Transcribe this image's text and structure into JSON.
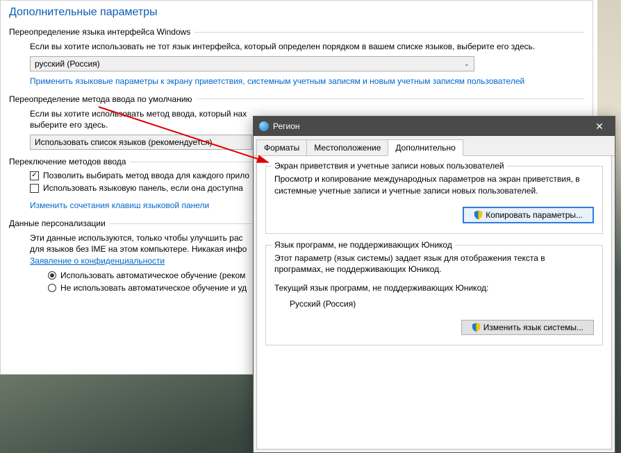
{
  "page": {
    "title": "Дополнительные параметры"
  },
  "group1": {
    "heading": "Переопределение языка интерфейса Windows",
    "desc": "Если вы хотите использовать не тот язык интерфейса, который определен порядком в вашем списке языков, выберите его здесь.",
    "dropdown_value": "русский (Россия)",
    "link": "Применить языковые параметры к экрану приветствия, системным учетным записям и новым учетным записям пользователей"
  },
  "group2": {
    "heading": "Переопределение метода ввода по умолчанию",
    "desc": "Если вы хотите использовать метод ввода, который нах",
    "dropdown_value": "Использовать список языков (рекомендуется)",
    "desc2": "выберите его здесь."
  },
  "group3": {
    "heading": "Переключение методов ввода",
    "check1": "Позволить выбирать метод ввода для каждого прило",
    "check2": "Использовать языковую панель, если она доступна",
    "link": "Изменить сочетания клавиш языковой панели"
  },
  "group4": {
    "heading": "Данные персонализации",
    "desc": "Эти данные используются, только чтобы улучшить рас",
    "desc2": "для языков без IME на этом компьютере. Никакая инфо",
    "link": "Заявление о конфиденциальности",
    "radio1": "Использовать автоматическое обучение (реком",
    "radio2": "Не использовать автоматическое обучение и уд"
  },
  "dialog": {
    "title": "Регион",
    "tabs": {
      "t1": "Форматы",
      "t2": "Местоположение",
      "t3": "Дополнительно"
    },
    "box1": {
      "legend": "Экран приветствия и учетные записи новых пользователей",
      "desc": "Просмотр и копирование международных параметров на экран приветствия, в системные учетные записи и учетные записи новых пользователей.",
      "button": "Копировать параметры..."
    },
    "box2": {
      "legend": "Язык программ, не поддерживающих Юникод",
      "desc": "Этот параметр (язык системы) задает язык для отображения текста в программах, не поддерживающих Юникод.",
      "curlabel": "Текущий язык программ, не поддерживающих Юникод:",
      "curval": "Русский (Россия)",
      "button": "Изменить язык системы..."
    }
  }
}
